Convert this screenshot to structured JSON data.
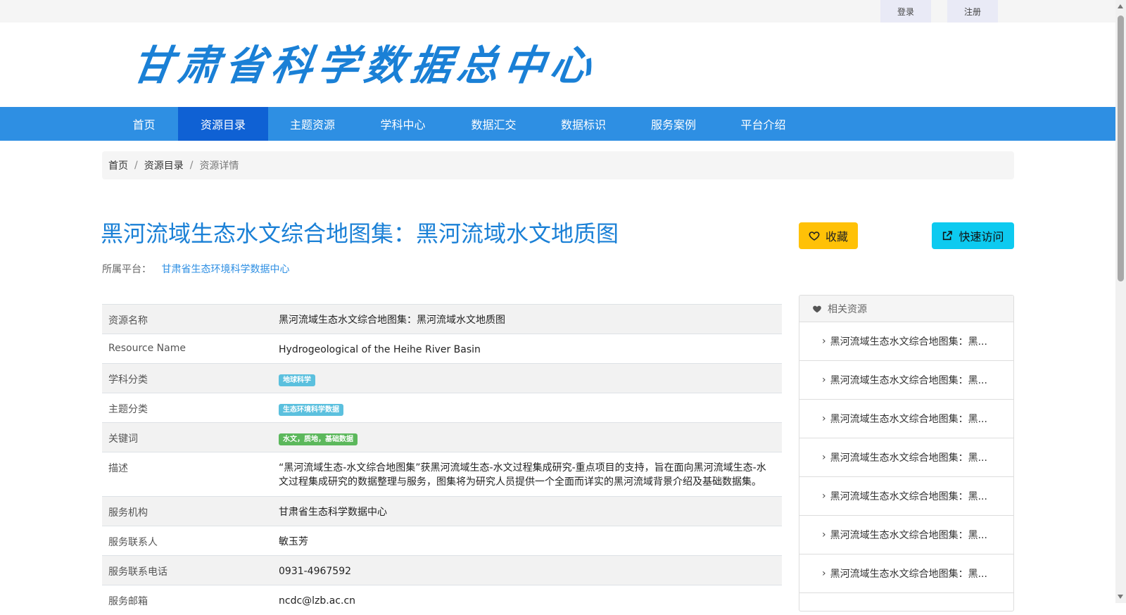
{
  "topbar": {
    "login": "登录",
    "register": "注册"
  },
  "header": {
    "logo_text": "甘肃省科学数据总中心"
  },
  "nav": [
    {
      "label": "首页"
    },
    {
      "label": "资源目录"
    },
    {
      "label": "主题资源"
    },
    {
      "label": "学科中心"
    },
    {
      "label": "数据汇交"
    },
    {
      "label": "数据标识"
    },
    {
      "label": "服务案例"
    },
    {
      "label": "平台介绍"
    }
  ],
  "breadcrumb": {
    "home": "首页",
    "catalog": "资源目录",
    "current": "资源详情",
    "separator": "/"
  },
  "title": "黑河流域生态水文综合地图集：黑河流域水文地质图",
  "platform": {
    "label": "所属平台：",
    "value": "甘肃省生态环境科学数据中心"
  },
  "buttons": {
    "favorite": "收藏",
    "visit": "快速访问"
  },
  "details": [
    {
      "label": "资源名称",
      "value": "黑河流域生态水文综合地图集：黑河流域水文地质图"
    },
    {
      "label": "Resource Name",
      "value": "Hydrogeological of the Heihe River Basin"
    },
    {
      "label": "学科分类",
      "tag": "地球科学"
    },
    {
      "label": "主题分类",
      "tag": "生态环境科学数据"
    },
    {
      "label": "关键词",
      "tag": "水文，质地，基础数据"
    },
    {
      "label": "描述",
      "value": "“黑河流域生态-水文综合地图集”获黑河流域生态-水文过程集成研究-重点项目的支持，旨在面向黑河流域生态-水文过程集成研究的数据整理与服务，图集将为研究人员提供一个全面而详实的黑河流域背景介绍及基础数据集。"
    },
    {
      "label": "服务机构",
      "value": "甘肃省生态科学数据中心"
    },
    {
      "label": "服务联系人",
      "value": "敏玉芳"
    },
    {
      "label": "服务联系电话",
      "value": "0931-4967592"
    },
    {
      "label": "服务邮箱",
      "value": "ncdc@lzb.ac.cn"
    }
  ],
  "related": {
    "title": "相关资源",
    "items": [
      "黑河流域生态水文综合地图集：黑...",
      "黑河流域生态水文综合地图集：黑...",
      "黑河流域生态水文综合地图集：黑...",
      "黑河流域生态水文综合地图集：黑...",
      "黑河流域生态水文综合地图集：黑...",
      "黑河流域生态水文综合地图集：黑...",
      "黑河流域生态水文综合地图集：黑..."
    ]
  },
  "colors": {
    "primary": "#2e8fe3",
    "nav_active": "#0f61d4",
    "title_blue": "#1a80d6",
    "favorite": "#ffc107",
    "visit": "#0dcaf0",
    "tag_blue": "#5bc0de",
    "tag_green": "#5cb85c"
  }
}
